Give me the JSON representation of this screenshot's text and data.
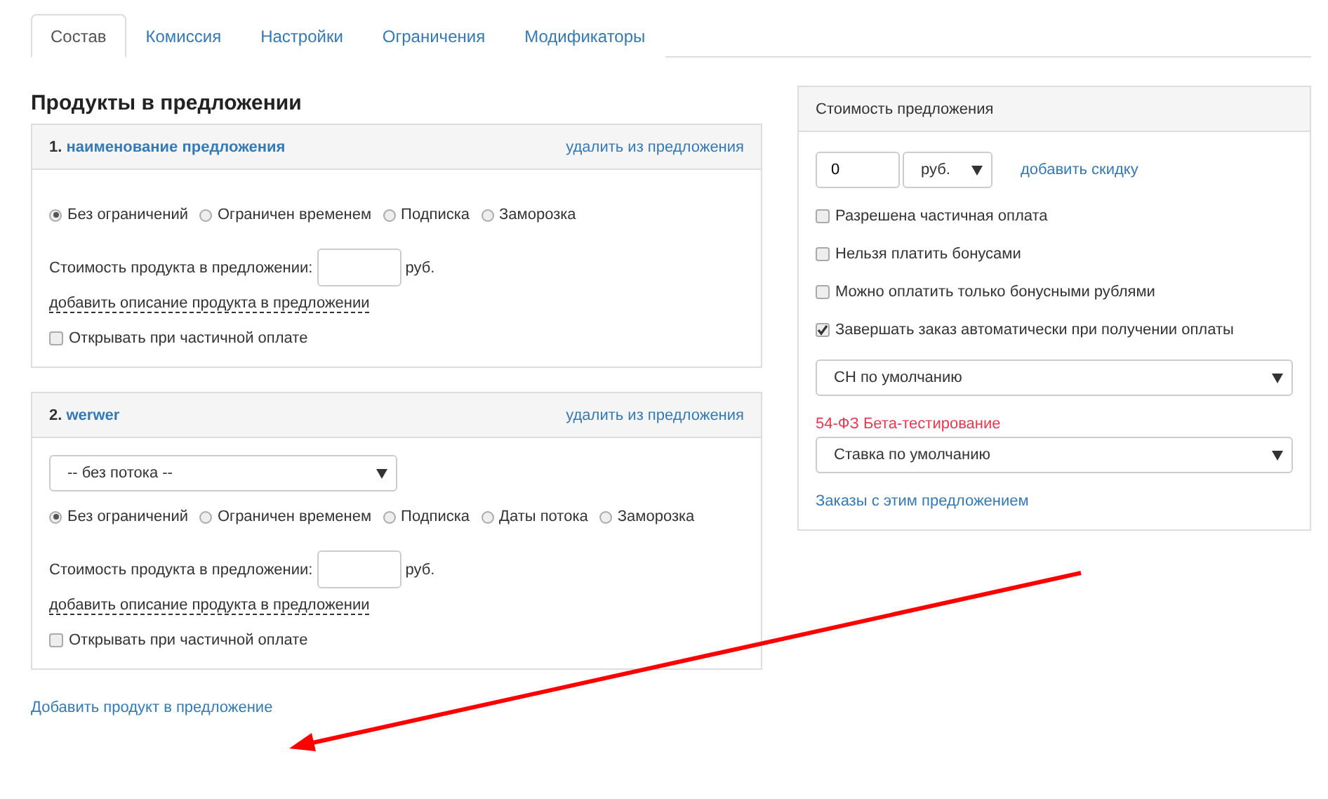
{
  "tabs": [
    {
      "label": "Состав",
      "selected": true
    },
    {
      "label": "Комиссия",
      "selected": false
    },
    {
      "label": "Настройки",
      "selected": false
    },
    {
      "label": "Ограничения",
      "selected": false
    },
    {
      "label": "Модификаторы",
      "selected": false
    }
  ],
  "products": {
    "title": "Продукты в предложении",
    "items": [
      {
        "number": "1.",
        "name": "наименование предложения",
        "remove_link": "удалить из предложения",
        "options": [
          {
            "label": "Без ограничений",
            "selected": true
          },
          {
            "label": "Ограничен временем",
            "selected": false
          },
          {
            "label": "Подписка",
            "selected": false
          },
          {
            "label": "Заморозка",
            "selected": false
          }
        ],
        "price_label": "Стоимость продукта в предложении:",
        "currency": "руб.",
        "description_link": "добавить описание продукта в предложении",
        "partial": {
          "label": "Открывать при частичной оплате",
          "checked": false
        }
      },
      {
        "number": "2.",
        "name": "werwer",
        "remove_link": "удалить из предложения",
        "stream_select": "-- без потока --",
        "options": [
          {
            "label": "Без ограничений",
            "selected": true
          },
          {
            "label": "Ограничен временем",
            "selected": false
          },
          {
            "label": "Подписка",
            "selected": false
          },
          {
            "label": "Даты потока",
            "selected": false
          },
          {
            "label": "Заморозка",
            "selected": false
          }
        ],
        "price_label": "Стоимость продукта в предложении:",
        "currency": "руб.",
        "description_link": "добавить описание продукта в предложении",
        "partial": {
          "label": "Открывать при частичной оплате",
          "checked": false
        }
      }
    ]
  },
  "add_product_link": "Добавить продукт в предложение",
  "cost_panel": {
    "title": "Стоимость предложения",
    "amount": "0",
    "currency_select": "руб.",
    "discount_link": "добавить скидку",
    "checkboxes": [
      {
        "label": "Разрешена частичная оплата",
        "checked": false
      },
      {
        "label": "Нельзя платить бонусами",
        "checked": false
      },
      {
        "label": "Можно оплатить только бонусными рублями",
        "checked": false
      },
      {
        "label": "Завершать заказ автоматически при получении оплаты",
        "checked": true
      }
    ],
    "tax_select": "СН по умолчанию",
    "beta_label": "54-ФЗ Бета-тестирование",
    "rate_select": "Ставка по умолчанию",
    "orders_link": "Заказы с этим предложением"
  }
}
